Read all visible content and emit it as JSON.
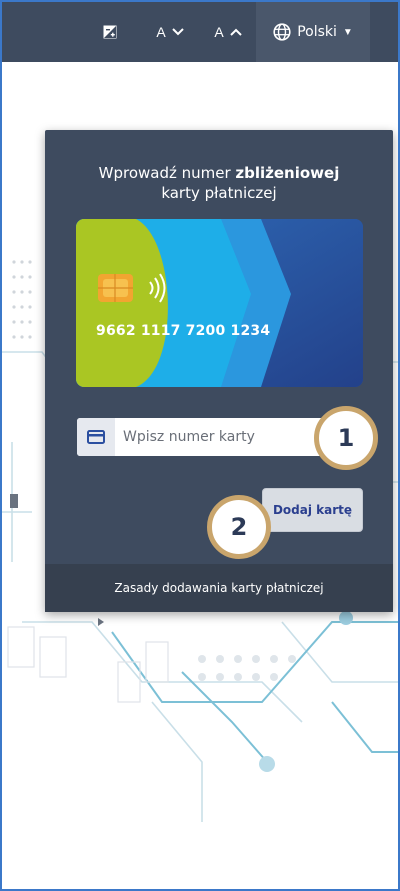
{
  "toolbar": {
    "contrast_icon": "contrast-icon",
    "font_decrease": "A",
    "font_increase": "A",
    "language": "Polski"
  },
  "card_form": {
    "prompt_prefix": "Wprowadź numer ",
    "prompt_bold": "zbliżeniowej",
    "prompt_suffix": "karty płatniczej",
    "card_number": "9662 1117 7200 1234",
    "input_placeholder": "Wpisz numer karty",
    "add_button": "Dodaj kartę",
    "rules_link": "Zasady dodawania karty płatniczej"
  },
  "markers": {
    "one": "1",
    "two": "2"
  },
  "colors": {
    "header": "#3e4b5f",
    "panel": "#3e4b5f",
    "footer": "#36404f",
    "button_text": "#2b3f8f",
    "marker_border": "#c9a56c",
    "card_lime": "#a9c524",
    "card_cyan": "#1fa9e6",
    "card_blue": "#2d5aa0"
  }
}
